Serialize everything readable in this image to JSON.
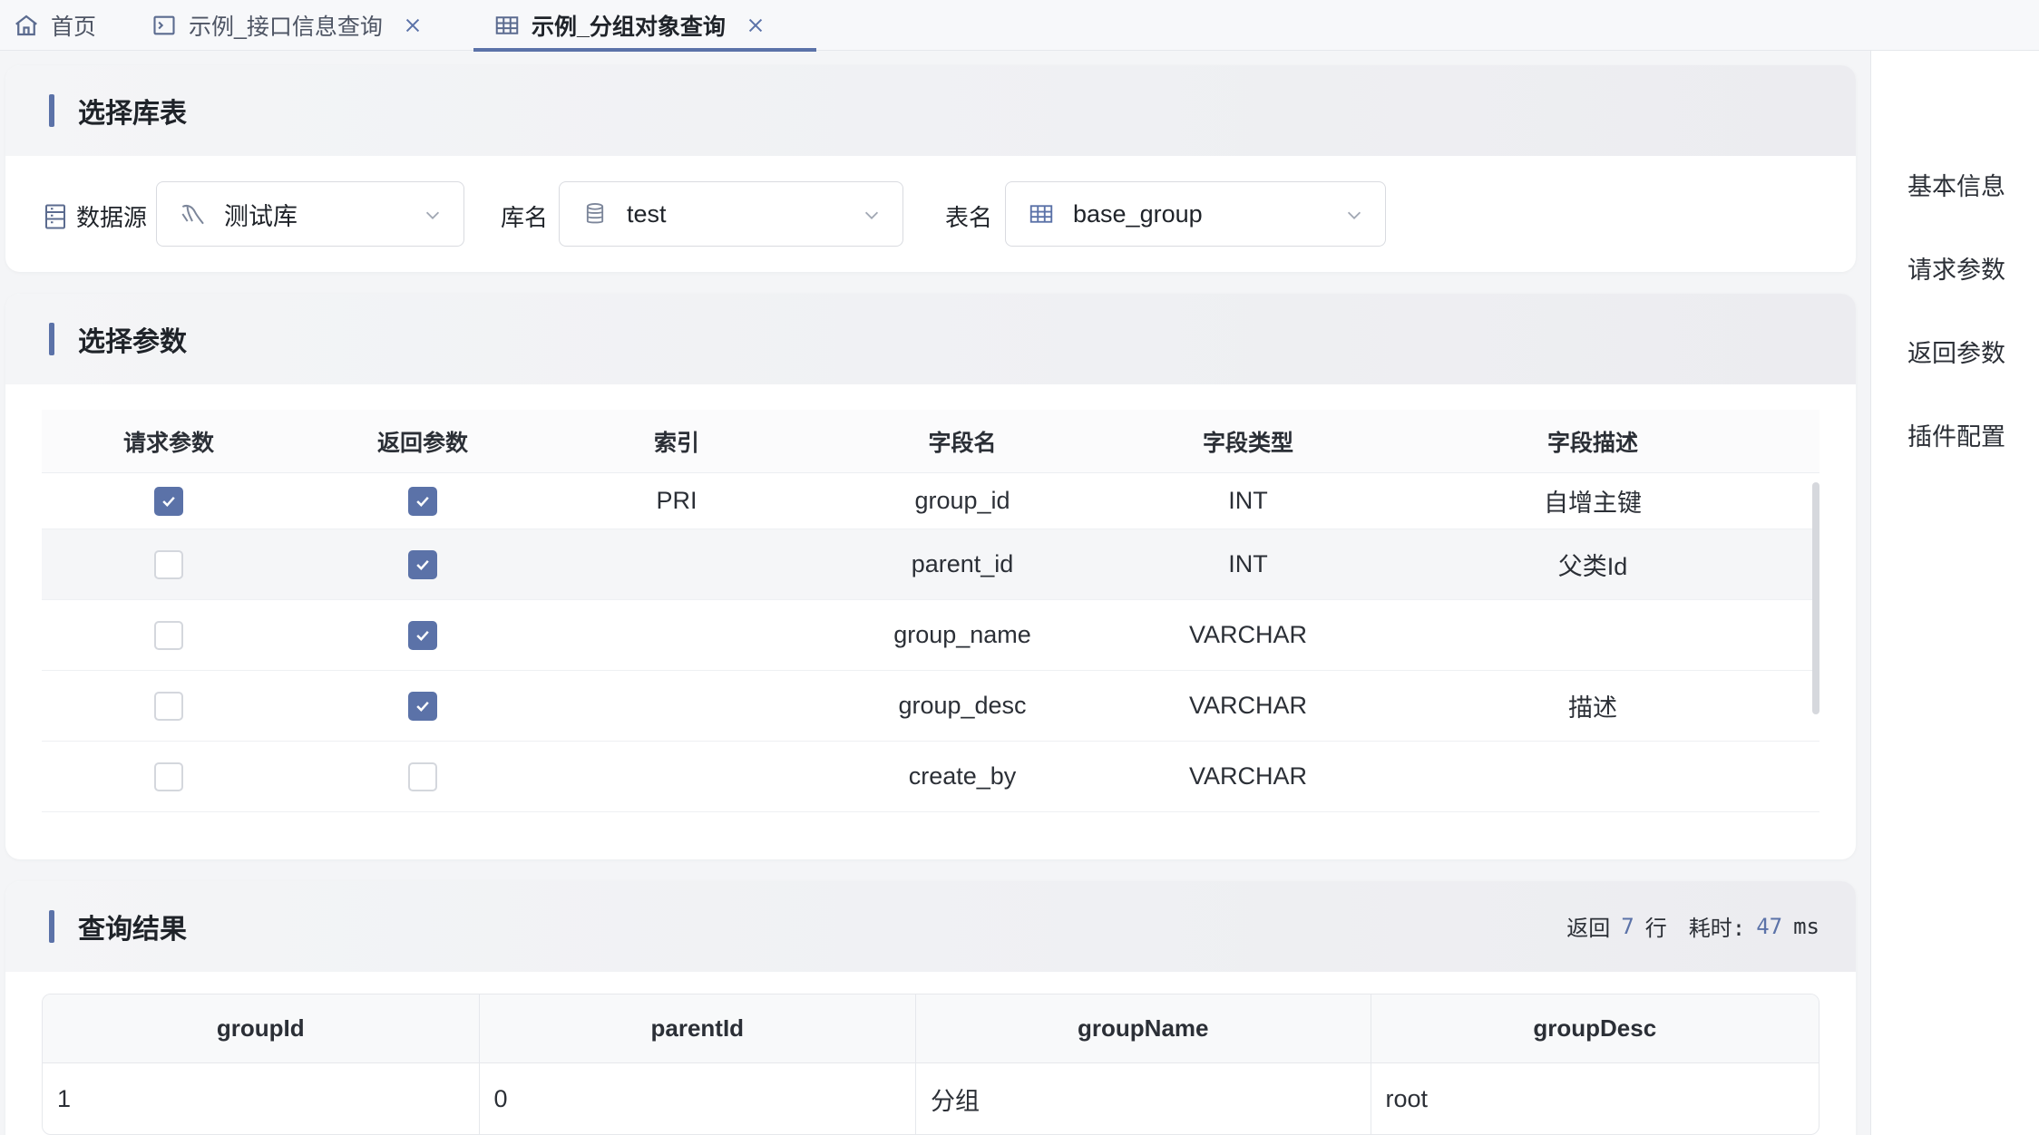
{
  "tabs": [
    {
      "label": "首页",
      "icon": "home-icon"
    },
    {
      "label": "示例_接口信息查询",
      "icon": "terminal-icon"
    },
    {
      "label": "示例_分组对象查询",
      "icon": "table-icon",
      "active": true
    }
  ],
  "select_section": {
    "title": "选择库表",
    "datasource_label": "数据源",
    "datasource_value": "测试库",
    "database_label": "库名",
    "database_value": "test",
    "table_label": "表名",
    "table_value": "base_group"
  },
  "params_section": {
    "title": "选择参数",
    "headers": [
      "请求参数",
      "返回参数",
      "索引",
      "字段名",
      "字段类型",
      "字段描述"
    ],
    "rows": [
      {
        "request": true,
        "response": true,
        "index": "PRI",
        "field": "group_id",
        "type": "INT",
        "desc": "自增主键"
      },
      {
        "request": false,
        "response": true,
        "index": "",
        "field": "parent_id",
        "type": "INT",
        "desc": "父类Id"
      },
      {
        "request": false,
        "response": true,
        "index": "",
        "field": "group_name",
        "type": "VARCHAR",
        "desc": ""
      },
      {
        "request": false,
        "response": true,
        "index": "",
        "field": "group_desc",
        "type": "VARCHAR",
        "desc": "描述"
      },
      {
        "request": false,
        "response": false,
        "index": "",
        "field": "create_by",
        "type": "VARCHAR",
        "desc": ""
      }
    ]
  },
  "result_section": {
    "title": "查询结果",
    "return_label": "返回",
    "row_count": "7",
    "row_unit": "行",
    "time_label": "耗时:",
    "time_value": "47",
    "time_unit": "ms",
    "headers": [
      "groupId",
      "parentId",
      "groupName",
      "groupDesc"
    ],
    "rows": [
      [
        "1",
        "0",
        "分组",
        "root"
      ]
    ]
  },
  "right_nav": [
    "基本信息",
    "请求参数",
    "返回参数",
    "插件配置"
  ],
  "colors": {
    "accent": "#5b72a8",
    "border": "#d9dbe0",
    "header_bg": "#f0f1f4"
  }
}
